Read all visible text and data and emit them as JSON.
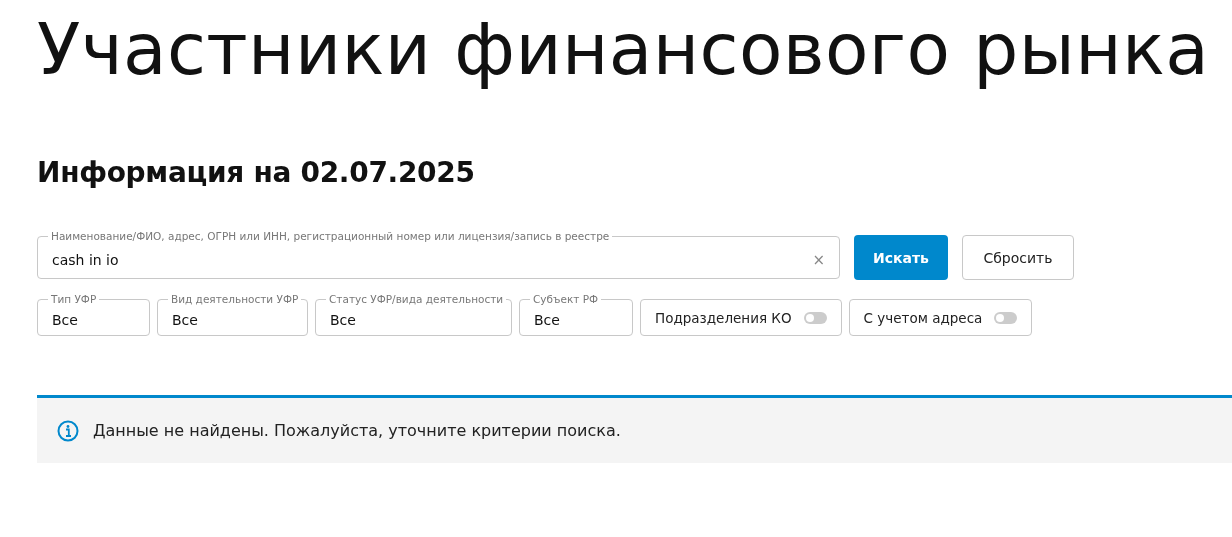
{
  "page_title": "Участники финансового рынка",
  "info_date": "Информация на 02.07.2025",
  "search": {
    "label": "Наименование/ФИО, адрес, ОГРН или ИНН, регистрационный номер или лицензия/запись в реестре",
    "value": "cash in io",
    "clear": "×"
  },
  "buttons": [
    {
      "label": "Искать",
      "kind": "primary"
    },
    {
      "label": "Сбросить",
      "kind": "secondary"
    }
  ],
  "filters": [
    {
      "label": "Тип УФР",
      "value": "Все"
    },
    {
      "label": "Вид деятельности УФР",
      "value": "Все"
    },
    {
      "label": "Статус УФР/вида деятельности",
      "value": "Все"
    },
    {
      "label": "Субъект РФ",
      "value": "Все"
    }
  ],
  "toggles": [
    {
      "label": "Подразделения КО",
      "on": false
    },
    {
      "label": "С учетом адреса",
      "on": false
    }
  ],
  "message": "Данные не найдены. Пожалуйста, уточните критерии поиска."
}
